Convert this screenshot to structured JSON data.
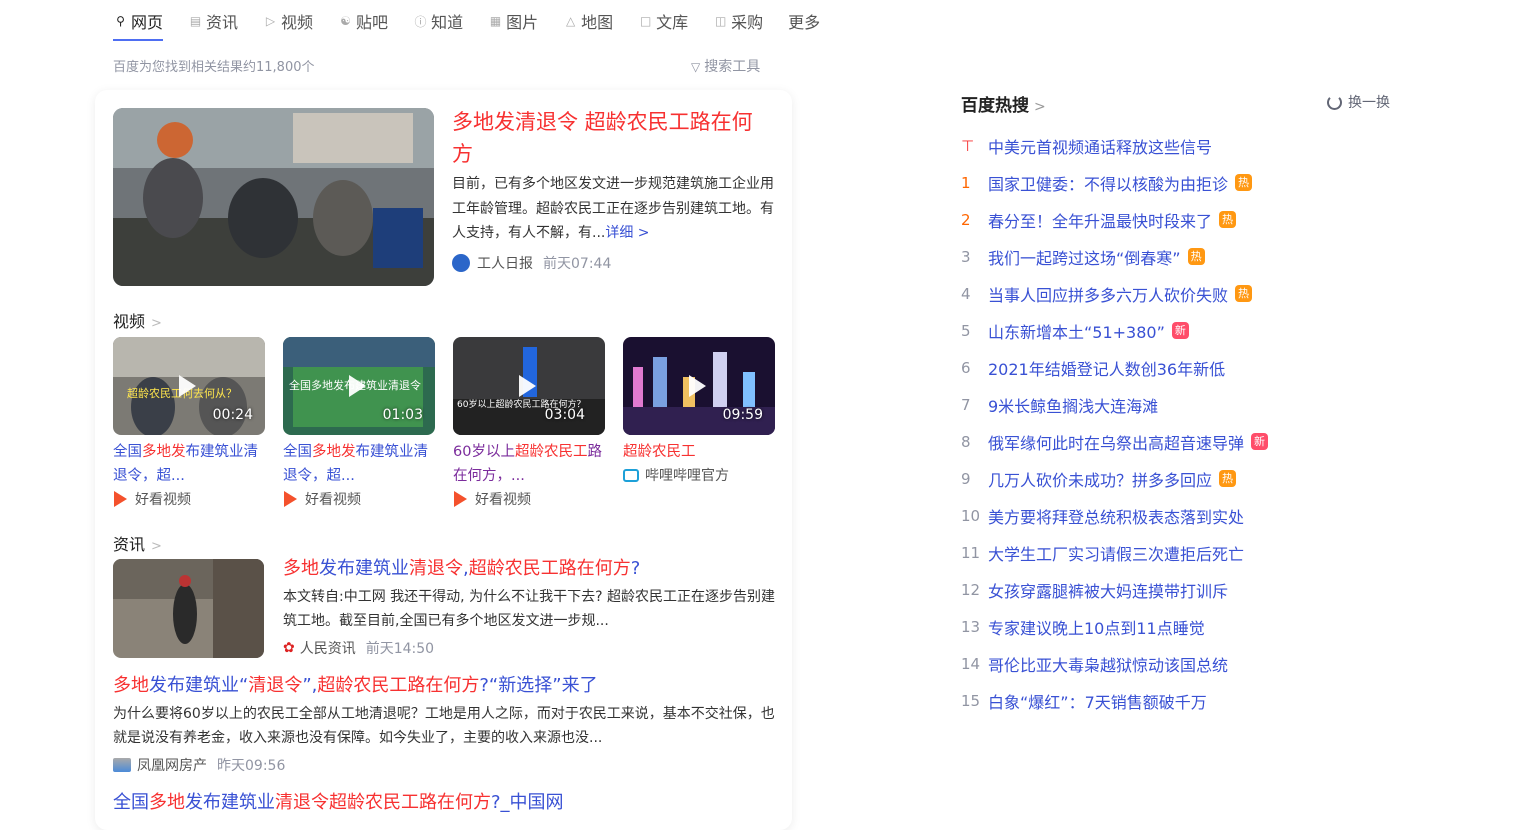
{
  "tabs": [
    {
      "label": "网页",
      "icon": "search-icon"
    },
    {
      "label": "资讯",
      "icon": "news-icon"
    },
    {
      "label": "视频",
      "icon": "video-icon"
    },
    {
      "label": "贴吧",
      "icon": "tieba-icon"
    },
    {
      "label": "知道",
      "icon": "question-icon"
    },
    {
      "label": "图片",
      "icon": "image-icon"
    },
    {
      "label": "地图",
      "icon": "map-icon"
    },
    {
      "label": "文库",
      "icon": "doc-icon"
    },
    {
      "label": "采购",
      "icon": "cart-icon"
    },
    {
      "label": "更多"
    }
  ],
  "result_count": "百度为您找到相关结果约11,800个",
  "search_tools": "搜索工具",
  "lead": {
    "title": "多地发清退令 超龄农民工路在何方",
    "desc": "目前，已有多个地区发文进一步规范建筑施工企业用工年龄管理。超龄农民工正在逐步告别建筑工地。有人支持，有人不解，有...",
    "more": "详细 >",
    "source": "工人日报",
    "time": "前天07:44"
  },
  "video_section": "视频",
  "videos": [
    {
      "duration": "00:24",
      "title_a": "全国",
      "title_b": "多地发",
      "title_c": "布建筑业清退令，超...",
      "source": "好看视频",
      "thumb_text": "超龄农民工何去何从？"
    },
    {
      "duration": "01:03",
      "title_a": "全国",
      "title_b": "多地发",
      "title_c": "布建筑业清退令，超...",
      "source": "好看视频",
      "thumb_text": "全国多地发布建筑业清退令"
    },
    {
      "duration": "03:04",
      "title_a": "60岁以上",
      "title_b": "超龄农民工",
      "title_c": "路在何方，...",
      "source": "好看视频",
      "thumb_text": "60岁以上超龄农民工路在何方？"
    },
    {
      "duration": "09:59",
      "title_a": "",
      "title_b": "超龄农民工",
      "title_c": "",
      "source": "哔哩哔哩官方",
      "thumb_text": ""
    }
  ],
  "news_section": "资讯",
  "news": [
    {
      "title_a": "多地",
      "title_b": "发布建筑业",
      "title_c": "清退令",
      "title_d": ",",
      "title_e": "超龄农民工路在何方",
      "title_f": "?",
      "desc": "本文转自:中工网 我还干得动, 为什么不让我干下去? 超龄农民工正在逐步告别建筑工地。截至目前,全国已有多个地区发文进一步规...",
      "source": "人民资讯",
      "time": "前天14:50"
    },
    {
      "title_a": "多地",
      "title_b": "发布建筑业“",
      "title_c": "清退令",
      "title_d": "”,",
      "title_e": "超龄农民工路在何方",
      "title_f": "?“新选择”来了",
      "desc": "为什么要将60岁以上的农民工全部从工地清退呢？工地是用人之际，而对于农民工来说，基本不交社保，也就是说没有养老金，收入来源也没有保障。如今失业了，主要的收入来源也没...",
      "source": "凤凰网房产",
      "time": "昨天09:56"
    },
    {
      "title_a": "全国",
      "title_b": "多地",
      "title_c": "发布建筑业",
      "title_d": "清退令",
      "title_e": "超龄农民工路在何方",
      "title_f": "?_中国网"
    }
  ],
  "hot": {
    "title": "百度热搜",
    "refresh": "换一换",
    "items": [
      {
        "rank": "",
        "text": "中美元首视频通话释放这些信号",
        "badge": ""
      },
      {
        "rank": "1",
        "text": "国家卫健委：不得以核酸为由拒诊",
        "badge": "热"
      },
      {
        "rank": "2",
        "text": "春分至！全年升温最快时段来了",
        "badge": "热"
      },
      {
        "rank": "3",
        "text": "我们一起跨过这场“倒春寒”",
        "badge": "热"
      },
      {
        "rank": "4",
        "text": "当事人回应拼多多六万人砍价失败",
        "badge": "热"
      },
      {
        "rank": "5",
        "text": "山东新增本土“51+380”",
        "badge": "新"
      },
      {
        "rank": "6",
        "text": "2021年结婚登记人数创36年新低",
        "badge": ""
      },
      {
        "rank": "7",
        "text": "9米长鲸鱼搁浅大连海滩",
        "badge": ""
      },
      {
        "rank": "8",
        "text": "俄军缘何此时在乌祭出高超音速导弹",
        "badge": "新"
      },
      {
        "rank": "9",
        "text": "几万人砍价未成功？拼多多回应",
        "badge": "热"
      },
      {
        "rank": "10",
        "text": "美方要将拜登总统积极表态落到实处",
        "badge": ""
      },
      {
        "rank": "11",
        "text": "大学生工厂实习请假三次遭拒后死亡",
        "badge": ""
      },
      {
        "rank": "12",
        "text": "女孩穿露腿裤被大妈连摸带打训斥",
        "badge": ""
      },
      {
        "rank": "13",
        "text": "专家建议晚上10点到11点睡觉",
        "badge": ""
      },
      {
        "rank": "14",
        "text": "哥伦比亚大毒枭越狱惊动该国总统",
        "badge": ""
      },
      {
        "rank": "15",
        "text": "白象“爆红”：7天销售额破千万",
        "badge": ""
      }
    ]
  }
}
